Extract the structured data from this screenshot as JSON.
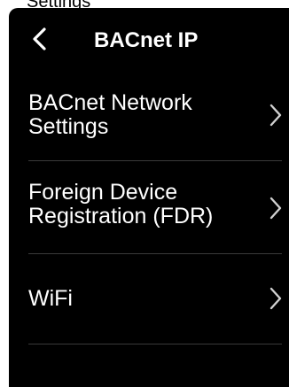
{
  "top_partial_text": "Settings",
  "header": {
    "title": "BACnet IP",
    "back_icon": "chevron-left-icon"
  },
  "menu": {
    "items": [
      {
        "label": "BACnet Network Settings",
        "icon": "chevron-right-icon"
      },
      {
        "label": "Foreign Device Registration (FDR)",
        "icon": "chevron-right-icon"
      },
      {
        "label": "WiFi",
        "icon": "chevron-right-icon"
      }
    ]
  },
  "colors": {
    "background": "#000000",
    "text": "#ffffff",
    "divider": "#3a3a3a"
  }
}
